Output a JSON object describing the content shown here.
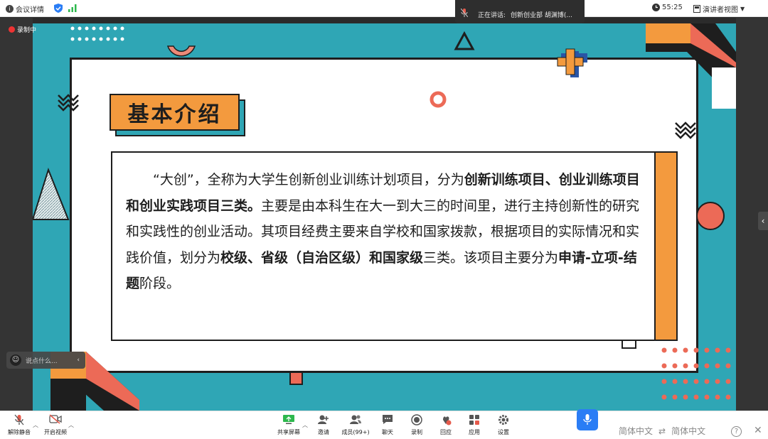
{
  "topbar": {
    "meeting_info": "会议详情",
    "timer": "55:25",
    "view_mode": "演讲者视图"
  },
  "speaker": {
    "prefix": "正在讲话:",
    "name": "创新创业部 胡渊博(..."
  },
  "recording": {
    "label": "录制中"
  },
  "slide": {
    "title": "基本介绍",
    "paragraph": [
      {
        "text": "“大创”，全称为大学生创新创业训练计划项目，分为",
        "bold": false
      },
      {
        "text": "创新训练项目、创业训练项目和创业实践项目三类。",
        "bold": true
      },
      {
        "text": "主要是由本科生在大一到大三的时间里，进行主持创新性的研究和实践性的创业活动。其项目经费主要来自学校和国家拨款，根据项目的实际情况和实践价值，划分为",
        "bold": false
      },
      {
        "text": "校级、省级（自治区级）和国家级",
        "bold": true
      },
      {
        "text": "三类。该项目主要分为",
        "bold": false
      },
      {
        "text": "申请-立项-结题",
        "bold": true
      },
      {
        "text": "阶段。",
        "bold": false
      }
    ],
    "colors": {
      "teal": "#2fa6b5",
      "orange": "#f39a3e",
      "coral": "#ec6a57",
      "ink": "#1e1e1e"
    }
  },
  "chat_hint": {
    "placeholder": "说点什么..."
  },
  "toolbar": {
    "unmute": "解除静音",
    "video": "开启视频",
    "share": "共享屏幕",
    "invite": "邀请",
    "members": "成员(99+)",
    "chat": "聊天",
    "record": "录制",
    "reaction": "回应",
    "apps": "应用",
    "settings": "设置"
  },
  "language": {
    "source": "简体中文",
    "target": "简体中文"
  },
  "icons": {
    "info": "info-icon",
    "shield": "shield-icon",
    "signal": "signal-icon",
    "clock": "clock-icon",
    "layout": "layout-icon",
    "mic_muted": "mic-muted-icon",
    "video_off": "video-off-icon",
    "share": "share-screen-icon",
    "invite": "invite-icon",
    "members": "members-icon",
    "chat": "chat-icon",
    "record": "record-icon",
    "reaction": "reaction-icon",
    "apps": "apps-icon",
    "settings": "gear-icon",
    "mic": "mic-icon",
    "swap": "swap-icon",
    "help": "help-icon",
    "close": "close-icon"
  }
}
